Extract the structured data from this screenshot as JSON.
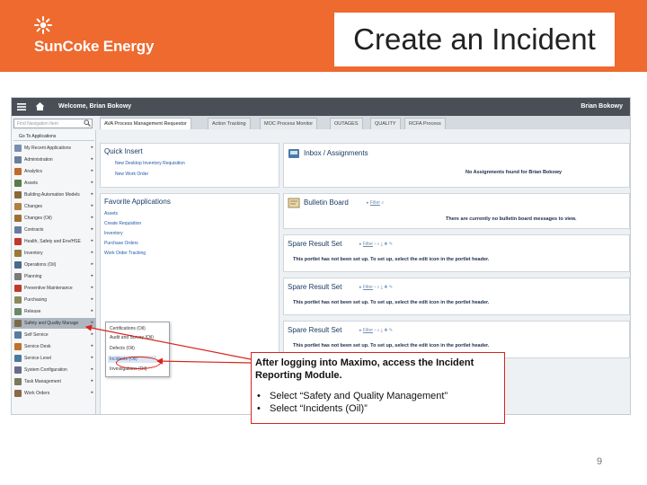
{
  "slide": {
    "title": "Create an Incident",
    "brand": "SunCoke Energy",
    "page_number": "9",
    "accent_color": "#ee6a2f",
    "callout_border_color": "#d9231d"
  },
  "app": {
    "welcome": "Welcome, Brian Bokowy",
    "user": "Brian Bokowy",
    "nav_search_placeholder": "Find Navigation Item",
    "go_to_applications": "Go To Applications",
    "tabs": [
      {
        "label": "AVA Process Management Requestor",
        "active": true
      },
      {
        "label": "Action Tracking",
        "active": false
      },
      {
        "label": "MOC Process Monitor",
        "active": false
      },
      {
        "label": "OUTAGES",
        "active": false
      },
      {
        "label": "QUALITY",
        "active": false
      },
      {
        "label": "RCFA Process",
        "active": false
      }
    ],
    "sidebar": [
      {
        "label": "My Recent Applications",
        "icon": "clock-icon",
        "color": "#7a8fb0"
      },
      {
        "label": "Administration",
        "icon": "admin-icon",
        "color": "#6b7f99"
      },
      {
        "label": "Analytics",
        "icon": "chart-icon",
        "color": "#c06a2b"
      },
      {
        "label": "Assets",
        "icon": "assets-icon",
        "color": "#5a7a4a"
      },
      {
        "label": "Building Automation Models",
        "icon": "building-icon",
        "color": "#8a6a3a"
      },
      {
        "label": "Changes",
        "icon": "changes-icon",
        "color": "#b08040"
      },
      {
        "label": "Changes (Oil)",
        "icon": "changes-oil-icon",
        "color": "#a07030"
      },
      {
        "label": "Contracts",
        "icon": "contracts-icon",
        "color": "#6a7aa0"
      },
      {
        "label": "Health, Safety and Env/HSE",
        "icon": "warning-icon",
        "color": "#c0392b"
      },
      {
        "label": "Inventory",
        "icon": "inventory-icon",
        "color": "#9a7a3a"
      },
      {
        "label": "Operations (Oil)",
        "icon": "operations-icon",
        "color": "#4a6a8a"
      },
      {
        "label": "Planning",
        "icon": "planning-icon",
        "color": "#7a7a7a"
      },
      {
        "label": "Preventive Maintenance",
        "icon": "maintenance-icon",
        "color": "#c0392b"
      },
      {
        "label": "Purchasing",
        "icon": "purchasing-icon",
        "color": "#8a8a5a"
      },
      {
        "label": "Release",
        "icon": "release-icon",
        "color": "#6a8a6a"
      },
      {
        "label": "Safety and Quality Manage",
        "icon": "safety-icon",
        "color": "#7a6a4a"
      },
      {
        "label": "Self Service",
        "icon": "self-service-icon",
        "color": "#5a7aa0"
      },
      {
        "label": "Service Desk",
        "icon": "service-desk-icon",
        "color": "#c0702b"
      },
      {
        "label": "Service Level",
        "icon": "service-level-icon",
        "color": "#4a7aa0"
      },
      {
        "label": "System Configuration",
        "icon": "config-icon",
        "color": "#6a6a8a"
      },
      {
        "label": "Task Management",
        "icon": "task-icon",
        "color": "#7a7a5a"
      },
      {
        "label": "Work Orders",
        "icon": "work-orders-icon",
        "color": "#8a6a4a"
      }
    ],
    "flyout": [
      "Certifications (Oil)",
      "Audit and Survey (Oil)",
      "Defects (Oil)",
      "Incidents (Oil)",
      "Investigations (Oil)"
    ],
    "quick_insert": {
      "title": "Quick Insert",
      "links": [
        "New Desktop Inventory Requisition",
        "New Work Order"
      ]
    },
    "favorites": {
      "title": "Favorite Applications",
      "links": [
        "Assets",
        "Create Requisition",
        "Inventory",
        "Purchase Orders",
        "Work Order Tracking"
      ]
    },
    "inbox": {
      "title": "Inbox / Assignments",
      "message": "No Assignments found for Brian Bokowy"
    },
    "bulletin": {
      "title": "Bulletin Board",
      "filter": "Filter",
      "message": "There are currently no bulletin board messages to view."
    },
    "spare_sets": [
      {
        "title": "Spare Result Set",
        "filter": "Filter",
        "message": "This portlet has not been set up. To set up, select the edit icon  in the portlet header."
      },
      {
        "title": "Spare Result Set",
        "filter": "Filter",
        "message": "This portlet has not been set up. To set up, select the edit icon  in the portlet header."
      },
      {
        "title": "Spare Result Set",
        "filter": "Filter",
        "message": "This portlet has not been set up. To set up, select the edit icon  in the portlet header."
      }
    ]
  },
  "callout": {
    "intro": "After logging into Maximo, access the  Incident Reporting Module.",
    "bullets": [
      "Select “Safety and Quality Management”",
      "Select “Incidents (Oil)”"
    ]
  }
}
